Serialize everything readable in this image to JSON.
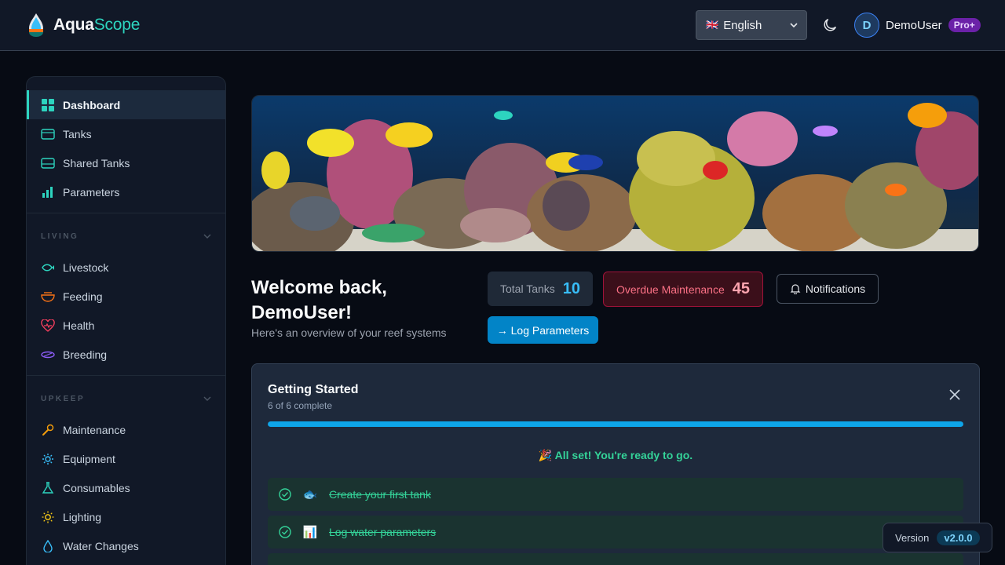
{
  "app": {
    "name_bold": "Aqua",
    "name_accent": "Scope"
  },
  "header": {
    "language": {
      "flag": "🇬🇧",
      "selected": "English"
    },
    "user": {
      "initial": "D",
      "name": "DemoUser",
      "plan_badge": "Pro+"
    }
  },
  "sidebar": {
    "main_items": [
      {
        "label": "Dashboard",
        "icon": "dashboard-icon",
        "active": true
      },
      {
        "label": "Tanks",
        "icon": "tank-icon"
      },
      {
        "label": "Shared Tanks",
        "icon": "shared-tank-icon"
      },
      {
        "label": "Parameters",
        "icon": "chart-icon"
      }
    ],
    "sections": [
      {
        "title": "LIVING",
        "items": [
          {
            "label": "Livestock",
            "icon": "fish-icon"
          },
          {
            "label": "Feeding",
            "icon": "bowl-icon"
          },
          {
            "label": "Health",
            "icon": "heart-pulse-icon"
          },
          {
            "label": "Breeding",
            "icon": "breeding-icon"
          }
        ]
      },
      {
        "title": "UPKEEP",
        "items": [
          {
            "label": "Maintenance",
            "icon": "wrench-icon"
          },
          {
            "label": "Equipment",
            "icon": "gear-icon"
          },
          {
            "label": "Consumables",
            "icon": "flask-icon"
          },
          {
            "label": "Lighting",
            "icon": "sun-icon"
          },
          {
            "label": "Water Changes",
            "icon": "droplet-icon"
          }
        ]
      }
    ]
  },
  "welcome": {
    "title_line1": "Welcome back,",
    "title_line2": "DemoUser!",
    "subtitle": "Here's an overview of your reef systems"
  },
  "stats": {
    "total_tanks_label": "Total Tanks",
    "total_tanks_value": "10",
    "overdue_label": "Overdue Maintenance",
    "overdue_value": "45"
  },
  "actions": {
    "notifications": "Notifications",
    "log_parameters": "→ Log Parameters"
  },
  "getting_started": {
    "title": "Getting Started",
    "progress_text": "6 of 6 complete",
    "progress_fraction": 1.0,
    "done_message": "🎉 All set! You're ready to go.",
    "tasks": [
      {
        "emoji": "🐟",
        "label": "Create your first tank"
      },
      {
        "emoji": "📊",
        "label": "Log water parameters"
      }
    ]
  },
  "version": {
    "label": "Version",
    "value": "v2.0.0"
  },
  "colors": {
    "accent": "#2dd4bf",
    "primary": "#0284c7",
    "danger": "#fb7185",
    "success": "#34d399"
  }
}
